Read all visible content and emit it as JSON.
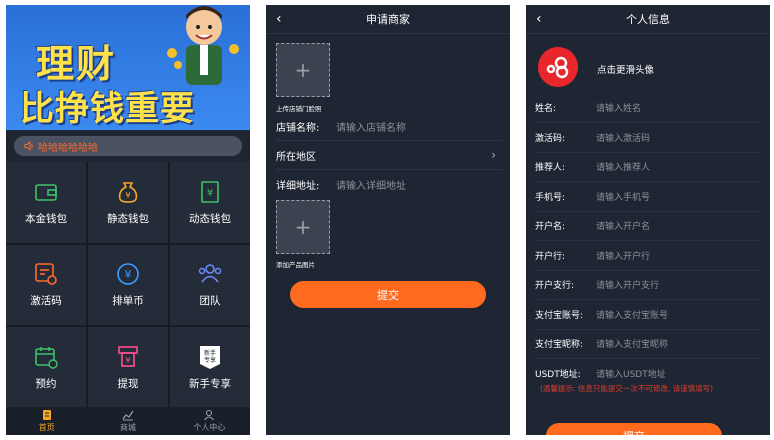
{
  "panel1": {
    "banner": {
      "line1": "理财",
      "line2": "比挣钱重要"
    },
    "notice": "哈哈哈哈哈哈",
    "grid": [
      {
        "label": "本金钱包",
        "icon": "wallet-icon",
        "color": "#3ec26a"
      },
      {
        "label": "静态钱包",
        "icon": "money-bag-icon",
        "color": "#f5a623"
      },
      {
        "label": "动态钱包",
        "icon": "yen-card-icon",
        "color": "#3ec26a"
      },
      {
        "label": "激活码",
        "icon": "activation-code-icon",
        "color": "#ff6a2e"
      },
      {
        "label": "排单币",
        "icon": "yen-coin-icon",
        "color": "#3d9bff"
      },
      {
        "label": "团队",
        "icon": "team-icon",
        "color": "#6b8cff"
      },
      {
        "label": "预约",
        "icon": "calendar-icon",
        "color": "#3ec26a"
      },
      {
        "label": "提现",
        "icon": "withdraw-icon",
        "color": "#ff4f8b"
      },
      {
        "label": "新手专享",
        "icon": "newbie-badge-icon",
        "color": "#ffffff",
        "badge_text": "新手\n专享"
      }
    ],
    "tabs": [
      {
        "label": "首页",
        "icon": "home-icon",
        "active": true
      },
      {
        "label": "商城",
        "icon": "chart-icon",
        "active": false
      },
      {
        "label": "个人中心",
        "icon": "user-icon",
        "active": false
      }
    ]
  },
  "panel2": {
    "title": "申请商家",
    "back": "‹",
    "upload1_caption": "上传店铺门脸照",
    "upload2_caption": "添加产品图片",
    "plus": "+",
    "fields": [
      {
        "label": "店铺名称:",
        "placeholder": "请输入店铺名称"
      },
      {
        "label": "所在地区",
        "placeholder": ""
      },
      {
        "label": "详细地址:",
        "placeholder": "请输入详细地址"
      }
    ],
    "chevron": "›",
    "submit": "提交"
  },
  "panel3": {
    "title": "个人信息",
    "back": "‹",
    "avatar_label": "点击更滑头像",
    "fields": [
      {
        "label": "姓名:",
        "placeholder": "请输入姓名"
      },
      {
        "label": "激活码:",
        "placeholder": "请输入激活码"
      },
      {
        "label": "推荐人:",
        "placeholder": "请输入推荐人"
      },
      {
        "label": "手机号:",
        "placeholder": "请输入手机号"
      },
      {
        "label": "开户名:",
        "placeholder": "请输入开户名"
      },
      {
        "label": "开户行:",
        "placeholder": "请输入开户行"
      },
      {
        "label": "开户支行:",
        "placeholder": "请输入开户支行"
      },
      {
        "label": "支付宝账号:",
        "placeholder": "请输入支付宝账号"
      },
      {
        "label": "支付宝昵称:",
        "placeholder": "请输入支付宝昵称"
      },
      {
        "label": "USDT地址:",
        "placeholder": "请输入USDT地址"
      }
    ],
    "warning": "(温馨提示: 信息只能提交一次不可修改, 请谨慎填写)",
    "submit": "提交"
  }
}
